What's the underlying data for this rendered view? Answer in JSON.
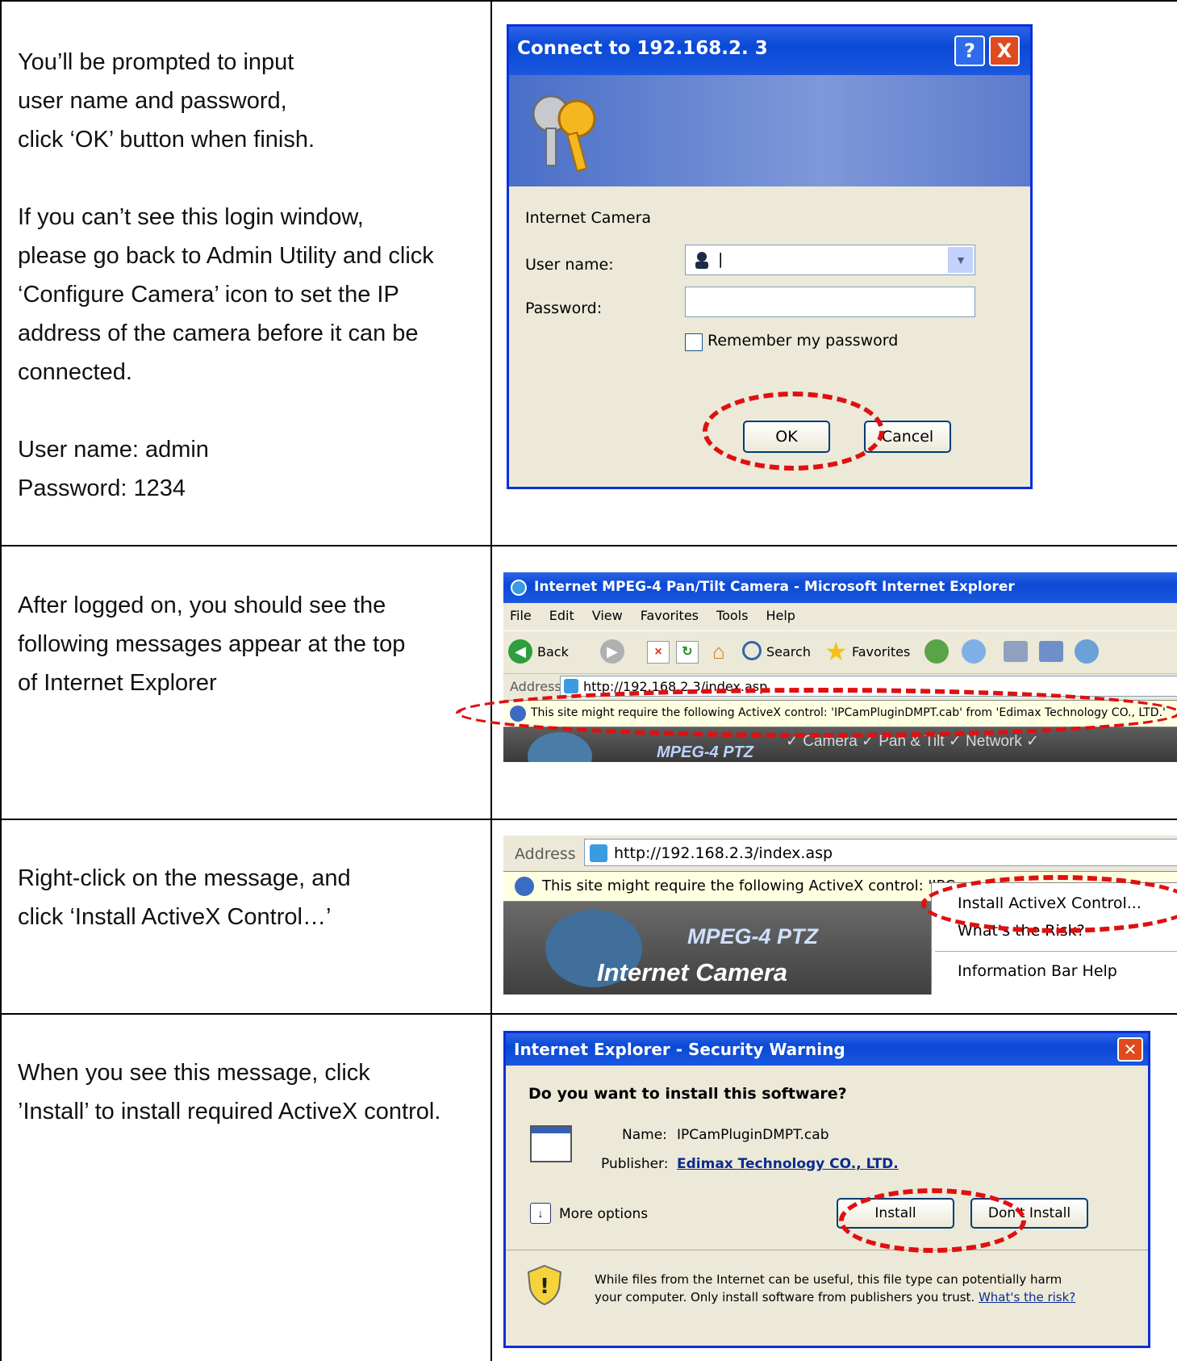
{
  "rows": [
    {
      "lines": [
        "You’ll be prompted to input",
        "user name and password,",
        "click ‘OK’ button when finish."
      ],
      "lines2": [
        "If you can’t see this login window,",
        "please go back to Admin Utility and click",
        "‘Configure Camera’ icon to set the IP",
        "address of the camera before it can be",
        "connected."
      ],
      "lines3": [
        "User name: admin",
        "Password: 1234"
      ]
    },
    {
      "lines": [
        "After logged on, you should see the",
        "following messages appear at the top",
        "of Internet Explorer"
      ]
    },
    {
      "lines": [
        "Right-click on the message, and",
        "click ‘Install ActiveX Control…’"
      ]
    },
    {
      "lines": [
        "When you see this message, click",
        "’Install’ to install required ActiveX control."
      ]
    }
  ],
  "login_dialog": {
    "title": "Connect to 192.168.2. 3",
    "help_btn": "?",
    "close_btn": "X",
    "realm": "Internet Camera",
    "username_label": "User name:",
    "username_value": "|",
    "password_label": "Password:",
    "remember_label": "Remember my password",
    "ok": "OK",
    "cancel": "Cancel"
  },
  "ie_window": {
    "title": "Internet MPEG-4 Pan/Tilt Camera - Microsoft Internet Explorer",
    "menu": [
      "File",
      "Edit",
      "View",
      "Favorites",
      "Tools",
      "Help"
    ],
    "back": "Back",
    "search": "Search",
    "favorites": "Favorites",
    "address_label": "Address",
    "url": "http://192.168.2.3/index.asp",
    "infobar": "This site might require the following ActiveX control: 'IPCamPluginDMPT.cab' from 'Edimax Technology CO., LTD.'",
    "page_nav": "✓ Camera   ✓ Pan & Tilt   ✓ Network   ✓",
    "page_logo": "MPEG-4 PTZ"
  },
  "ie_menu": {
    "address_label": "Address",
    "url": "http://192.168.2.3/index.asp",
    "infobar": "This site might require the following ActiveX control: 'IPCam",
    "items": [
      "Install ActiveX Control...",
      "What's the Risk?",
      "Information Bar Help"
    ],
    "logo1": "MPEG-4 PTZ",
    "logo2": "Internet Camera"
  },
  "security_dialog": {
    "title": "Internet Explorer - Security Warning",
    "question": "Do you want to install this software?",
    "name_label": "Name:",
    "name_value": "IPCamPluginDMPT.cab",
    "publisher_label": "Publisher:",
    "publisher_value": "Edimax Technology CO., LTD.",
    "more_options": "More options",
    "install": "Install",
    "dont_install": "Don't Install",
    "warning1": "While files from the Internet can be useful, this file type can potentially harm",
    "warning2": "your computer. Only install software from publishers you trust.",
    "risk_link": "What's the risk?"
  }
}
